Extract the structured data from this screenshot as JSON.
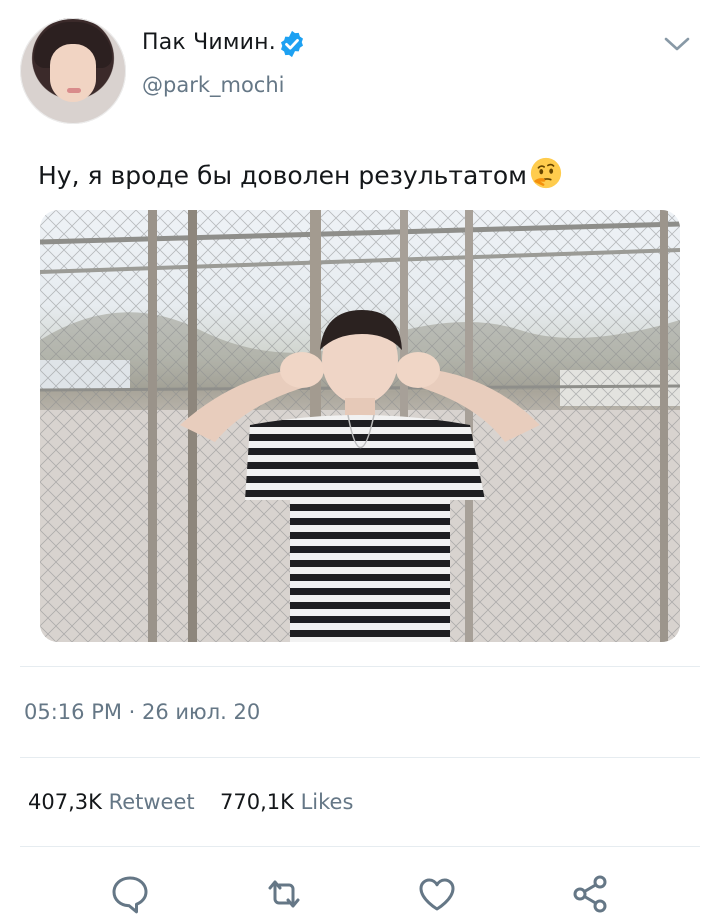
{
  "author": {
    "display_name": "Пак Чимин.",
    "handle": "@park_mochi",
    "verified": true
  },
  "tweet": {
    "text": "Ну, я вроде бы доволен результатом",
    "emoji": "thinking-face-icon"
  },
  "meta": {
    "timestamp": "05:16 PM · 26 июл. 20"
  },
  "stats": {
    "retweets_count": "407,3K",
    "retweets_label": "Retweet",
    "likes_count": "770,1K",
    "likes_label": "Likes"
  },
  "actions": [
    "reply-icon",
    "retweet-icon",
    "like-icon",
    "share-icon"
  ],
  "colors": {
    "verified_blue": "#1da1f2",
    "secondary_text": "#657786",
    "primary_text": "#14171a",
    "divider": "#e6ecf0"
  }
}
